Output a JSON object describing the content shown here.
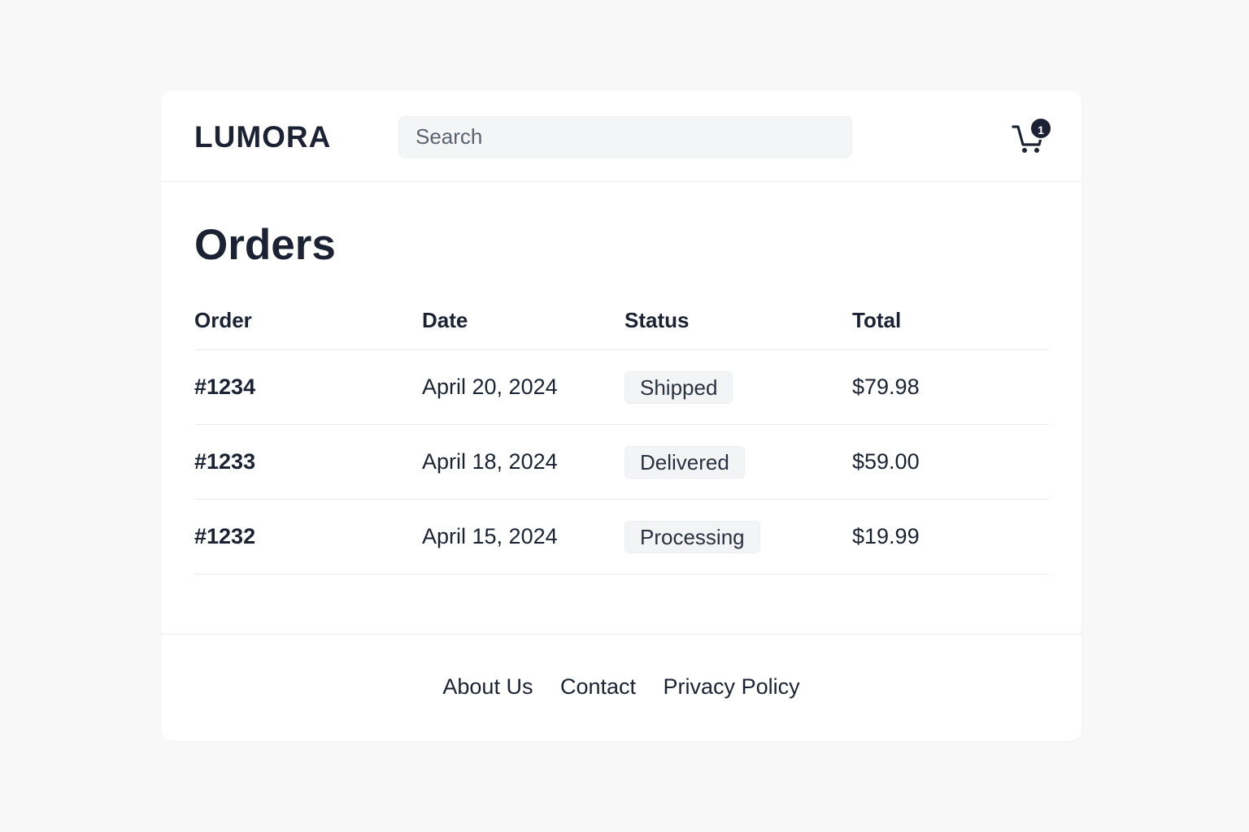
{
  "header": {
    "logo": "LUMORA",
    "search_placeholder": "Search",
    "cart_count": "1"
  },
  "main": {
    "title": "Orders",
    "columns": [
      "Order",
      "Date",
      "Status",
      "Total"
    ],
    "orders": [
      {
        "id": "#1234",
        "date": "April 20, 2024",
        "status": "Shipped",
        "total": "$79.98"
      },
      {
        "id": "#1233",
        "date": "April 18, 2024",
        "status": "Delivered",
        "total": "$59.00"
      },
      {
        "id": "#1232",
        "date": "April 15, 2024",
        "status": "Processing",
        "total": "$19.99"
      }
    ]
  },
  "footer": {
    "links": [
      "About Us",
      "Contact",
      "Privacy Policy"
    ]
  },
  "icons": {
    "cart": "cart-icon"
  },
  "colors": {
    "text": "#1b2233",
    "background": "#f8f8f8",
    "card": "#ffffff",
    "badge_bg": "#f3f4f5"
  }
}
